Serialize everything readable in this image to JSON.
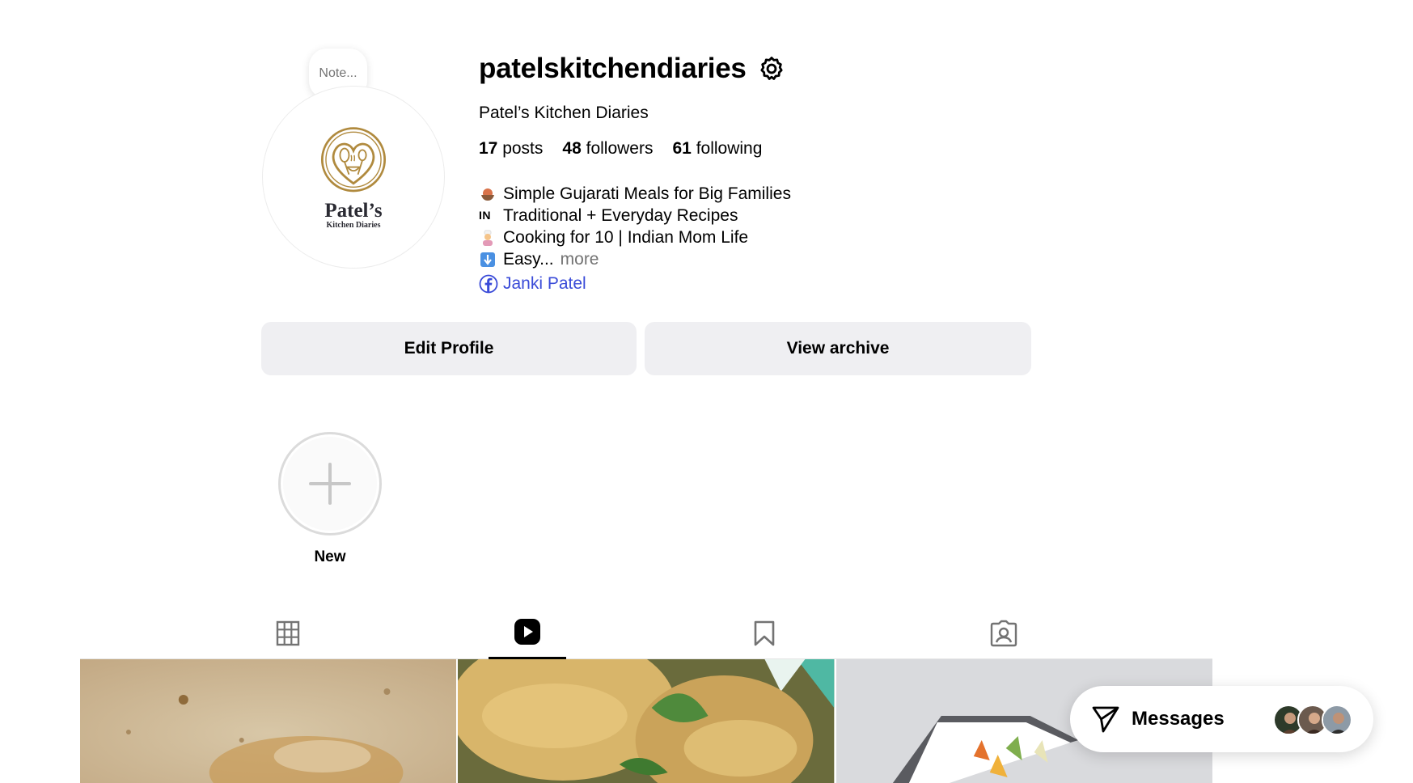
{
  "profile": {
    "note_placeholder": "Note...",
    "logo_name": "Patel’s",
    "logo_sub": "Kitchen Diaries",
    "username": "patelskitchendiaries",
    "full_name": "Patel’s Kitchen Diaries",
    "stats": {
      "posts_count": "17",
      "posts_label": "posts",
      "followers_count": "48",
      "followers_label": "followers",
      "following_count": "61",
      "following_label": "following"
    },
    "bio": {
      "line1": "Simple Gujarati Meals for Big Families",
      "line2_flag": "IN",
      "line2": "Traditional + Everyday Recipes",
      "line3": "Cooking for 10 | Indian Mom Life",
      "line4": "Easy...",
      "more": "more"
    },
    "link_text": "Janki Patel"
  },
  "actions": {
    "edit_profile": "Edit Profile",
    "view_archive": "View archive"
  },
  "highlights": {
    "new_label": "New"
  },
  "tabs": [
    {
      "name": "posts",
      "icon": "grid-icon",
      "active": false
    },
    {
      "name": "reels",
      "icon": "reels-icon",
      "active": true
    },
    {
      "name": "saved",
      "icon": "bookmark-icon",
      "active": false
    },
    {
      "name": "tagged",
      "icon": "tagged-icon",
      "active": false
    }
  ],
  "messages": {
    "label": "Messages"
  },
  "colors": {
    "link": "#3a4bd8",
    "button_bg": "#efeff2",
    "muted": "#737373",
    "logo_gold": "#b08a3e"
  }
}
